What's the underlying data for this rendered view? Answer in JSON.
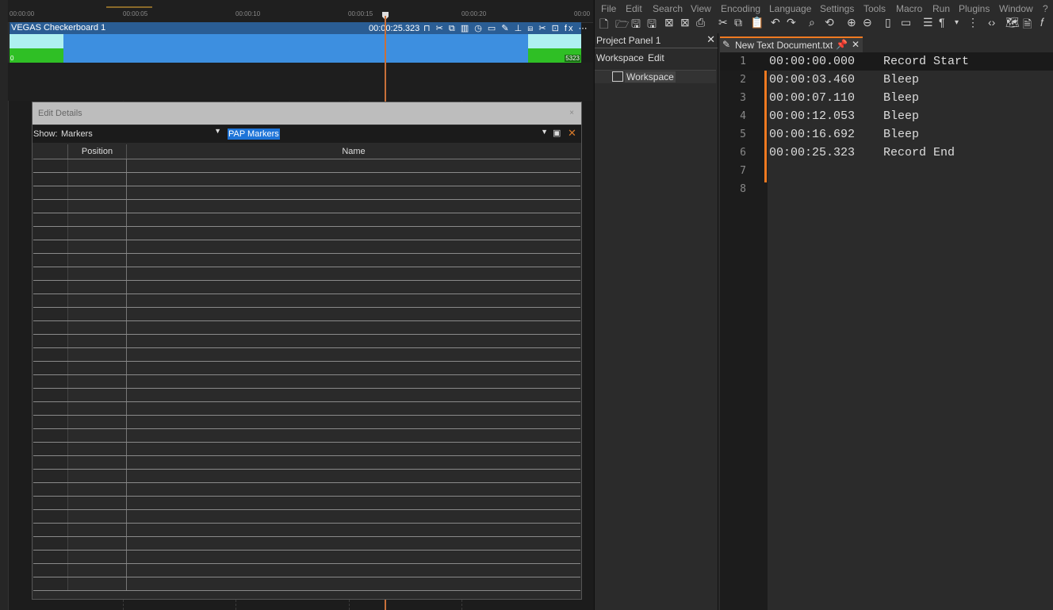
{
  "vegas": {
    "ruler_ticks": [
      "00:00:00",
      "00:00:05",
      "00:00:10",
      "00:00:15",
      "00:00:20",
      "00:00"
    ],
    "event": {
      "title": "VEGAS Checkerboard 1",
      "timecode": "00:00:25.323",
      "start_frame": "0",
      "end_frame": "5323",
      "fx_icons": "⊓ ✂ ⧉ ▥ ◷ ▭ ✎ ⊥ ⧈ ✂ ⊡ fx ⋯"
    },
    "edit_details": {
      "title": "Edit Details",
      "close_label": "×",
      "show_label": "Show:",
      "show_value": "Markers",
      "list_value": "PAP Markers",
      "columns": [
        "Position",
        "Name"
      ],
      "empty_rows": 32
    }
  },
  "notepad": {
    "menu": [
      "File",
      "Edit",
      "Search",
      "View",
      "Encoding",
      "Language",
      "Settings",
      "Tools",
      "Macro",
      "Run",
      "Plugins",
      "Window",
      "?"
    ],
    "project_panel": {
      "title": "Project Panel 1",
      "close": "✕",
      "menu": [
        "Workspace",
        "Edit"
      ],
      "tree_root": "Workspace"
    },
    "tab": {
      "title": "New Text Document.txt",
      "close": "✕"
    },
    "lines": [
      {
        "num": "1",
        "text": "00:00:00.000    Record Start"
      },
      {
        "num": "2",
        "text": "00:00:03.460    Bleep"
      },
      {
        "num": "3",
        "text": "00:00:07.110    Bleep"
      },
      {
        "num": "4",
        "text": "00:00:12.053    Bleep"
      },
      {
        "num": "5",
        "text": "00:00:16.692    Bleep"
      },
      {
        "num": "6",
        "text": "00:00:25.323    Record End"
      },
      {
        "num": "7",
        "text": ""
      },
      {
        "num": "8",
        "text": ""
      }
    ]
  }
}
